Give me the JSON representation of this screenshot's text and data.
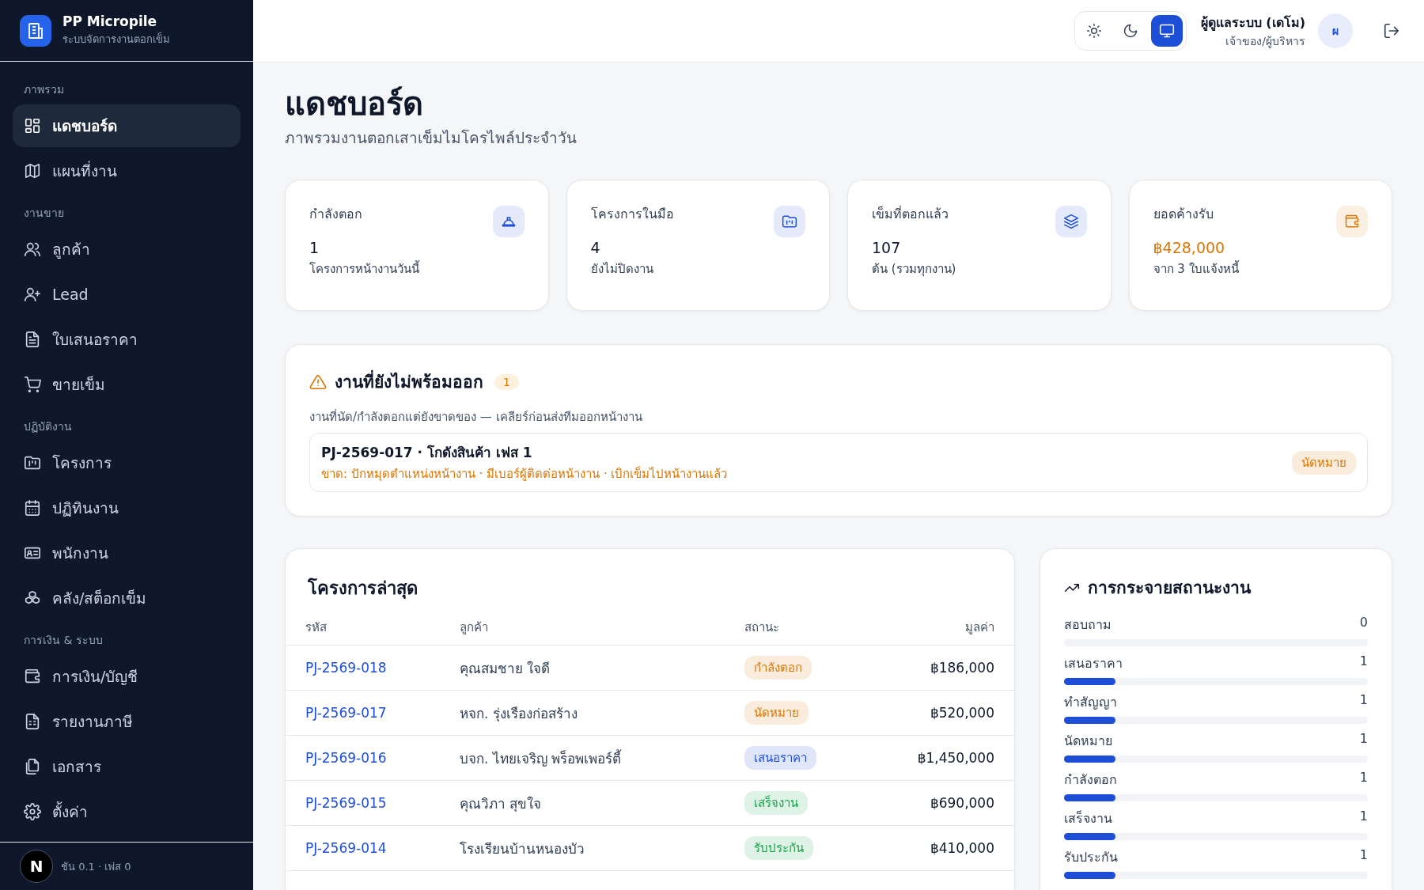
{
  "sidebar": {
    "brand": {
      "title": "PP Micropile",
      "subtitle": "ระบบจัดการงานตอกเข็ม"
    },
    "sections": [
      {
        "label": "ภาพรวม",
        "items": [
          {
            "label": "แดชบอร์ด",
            "selected": true
          },
          {
            "label": "แผนที่งาน",
            "selected": false
          }
        ]
      },
      {
        "label": "งานขาย",
        "items": [
          {
            "label": "ลูกค้า",
            "selected": false
          },
          {
            "label": "Lead",
            "selected": false
          },
          {
            "label": "ใบเสนอราคา",
            "selected": false
          },
          {
            "label": "ขายเข็ม",
            "selected": false
          }
        ]
      },
      {
        "label": "ปฏิบัติงาน",
        "items": [
          {
            "label": "โครงการ",
            "selected": false
          },
          {
            "label": "ปฏิทินงาน",
            "selected": false
          },
          {
            "label": "พนักงาน",
            "selected": false
          },
          {
            "label": "คลัง/สต็อกเข็ม",
            "selected": false
          }
        ]
      },
      {
        "label": "การเงิน & ระบบ",
        "items": [
          {
            "label": "การเงิน/บัญชี",
            "selected": false
          },
          {
            "label": "รายงานภาษี",
            "selected": false
          },
          {
            "label": "เอกสาร",
            "selected": false
          },
          {
            "label": "ตั้งค่า",
            "selected": false
          }
        ]
      }
    ],
    "footer": "ชัน 0.1 · เฟส 0",
    "dev_badge": "N"
  },
  "header": {
    "theme_options": [
      {
        "selected": false
      },
      {
        "selected": false
      },
      {
        "selected": true
      }
    ],
    "user": {
      "name": "ผู้ดูแลระบบ (เดโม)",
      "role": "เจ้าของ/ผู้บริหาร",
      "initial": "ผ"
    }
  },
  "page": {
    "title": "แดชบอร์ด",
    "subtitle": "ภาพรวมงานตอกเสาเข็มไมโครไพล์ประจำวัน"
  },
  "stats": [
    {
      "label": "กำลังตอก",
      "value": "1",
      "note": "โครงการหน้างานวันนี้",
      "color": "#1d4ed8",
      "highlight": false
    },
    {
      "label": "โครงการในมือ",
      "value": "4",
      "note": "ยังไม่ปิดงาน",
      "color": "#1d4ed8",
      "highlight": false
    },
    {
      "label": "เข็มที่ตอกแล้ว",
      "value": "107",
      "note": "ต้น (รวมทุกงาน)",
      "color": "#1d4ed8",
      "highlight": false
    },
    {
      "label": "ยอดค้างรับ",
      "value": "฿428,000",
      "note": "จาก 3 ใบแจ้งหนี้",
      "color": "#d97706",
      "highlight": true
    }
  ],
  "alert": {
    "title": "งานที่ยังไม่พร้อมออก",
    "count": "1",
    "description": "งานที่นัด/กำลังตอกแต่ยังขาดของ — เคลียร์ก่อนส่งทีมออกหน้างาน",
    "items": [
      {
        "title": "PJ-2569-017 · โกดังสินค้า เฟส 1",
        "missing": "ขาด: ปักหมุดตำแหน่งหน้างาน · มีเบอร์ผู้ติดต่อหน้างาน · เบิกเข็มไปหน้างานแล้ว",
        "status": "นัดหมาย",
        "color": "#d97706"
      }
    ]
  },
  "projects": {
    "title": "โครงการล่าสุด",
    "columns": [
      "รหัส",
      "ลูกค้า",
      "สถานะ",
      "มูลค่า"
    ],
    "rows": [
      {
        "code": "PJ-2569-018",
        "customer": "คุณสมชาย ใจดี",
        "status": "กำลังตอก",
        "color": "#d97706",
        "value": "฿186,000"
      },
      {
        "code": "PJ-2569-017",
        "customer": "หจก. รุ่งเรืองก่อสร้าง",
        "status": "นัดหมาย",
        "color": "#d97706",
        "value": "฿520,000"
      },
      {
        "code": "PJ-2569-016",
        "customer": "บจก. ไทยเจริญ พร็อพเพอร์ตี้",
        "status": "เสนอราคา",
        "color": "#1d4ed8",
        "value": "฿1,450,000"
      },
      {
        "code": "PJ-2569-015",
        "customer": "คุณวิภา สุขใจ",
        "status": "เสร็จงาน",
        "color": "#16a34a",
        "value": "฿690,000"
      },
      {
        "code": "PJ-2569-014",
        "customer": "โรงเรียนบ้านหนองบัว",
        "status": "รับประกัน",
        "color": "#16a34a",
        "value": "฿410,000"
      }
    ]
  },
  "distribution": {
    "title": "การกระจายสถานะงาน",
    "items": [
      {
        "label": "สอบถาม",
        "count": "0",
        "level": 0
      },
      {
        "label": "เสนอราคา",
        "count": "1",
        "level": 0.17
      },
      {
        "label": "ทำสัญญา",
        "count": "1",
        "level": 0.17
      },
      {
        "label": "นัดหมาย",
        "count": "1",
        "level": 0.17
      },
      {
        "label": "กำลังตอก",
        "count": "1",
        "level": 0.17
      },
      {
        "label": "เสร็จงาน",
        "count": "1",
        "level": 0.17
      },
      {
        "label": "รับประกัน",
        "count": "1",
        "level": 0.17
      }
    ]
  }
}
